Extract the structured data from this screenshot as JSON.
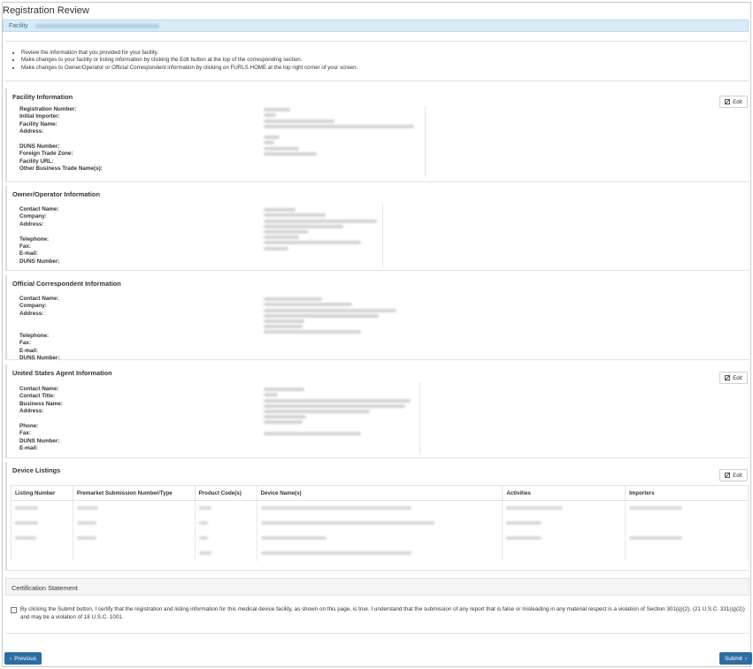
{
  "page": {
    "title": "Registration Review",
    "facility_label": "Facility"
  },
  "instructions": [
    "Review the information that you provided for your facility.",
    "Make changes to your facility or listing information by clicking the Edit button at the top of the corresponding section.",
    "Make changes to Owner/Operator or Official Correspondent information by clicking on FURLS HOME at the top right corner of your screen."
  ],
  "edit_label": "Edit",
  "facility_info": {
    "title": "Facility Information",
    "labels": [
      "Registration Number:",
      "Initial Importer:",
      "Facility Name:",
      "Address:",
      "",
      "DUNS Number:",
      "Foreign Trade Zone:",
      "Facility URL:",
      "Other Business Trade Name(s):"
    ]
  },
  "owner_info": {
    "title": "Owner/Operator Information",
    "labels": [
      "Contact Name:",
      "Company:",
      "Address:",
      "",
      "Telephone:",
      "Fax:",
      "E-mail:",
      "DUNS Number:"
    ]
  },
  "correspondent_info": {
    "title": "Official Correspondent Information",
    "labels": [
      "Contact Name:",
      "Company:",
      "Address:",
      "",
      "Telephone:",
      "Fax:",
      "E-mail:",
      "DUNS Number:"
    ]
  },
  "agent_info": {
    "title": "United States Agent Information",
    "labels": [
      "Contact Name:",
      "Contact Title:",
      "Business Name:",
      "Address:",
      "",
      "Phone:",
      "Fax:",
      "DUNS Number:",
      "E-mail:"
    ]
  },
  "device_listings": {
    "title": "Device Listings",
    "columns": [
      "Listing Number",
      "Premarket Submission Number/Type",
      "Product Code(s)",
      "Device Name(s)",
      "Activities",
      "Importers"
    ]
  },
  "certification": {
    "title": "Certification Statement",
    "text": "By clicking the Submit button, I certify that the registration and listing information for this medical device facility, as shown on this page, is true. I understand that the submission of any report that is false or misleading in any material respect is a violation of Section 301(q)(2), (21 U.S.C. 331(q)(2)) and may be a violation of 18 U.S.C. 1001."
  },
  "buttons": {
    "previous": "Previous",
    "submit": "Submit"
  },
  "colors": {
    "primary_button": "#2e6da4",
    "facility_bar": "#d9ebf7"
  }
}
